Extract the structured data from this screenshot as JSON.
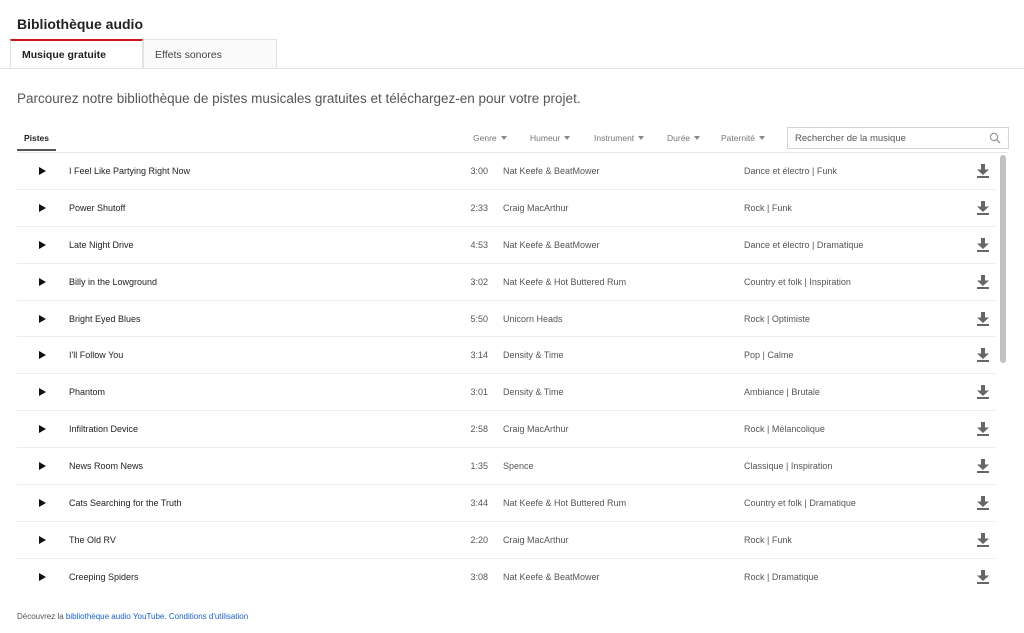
{
  "header": {
    "title": "Bibliothèque audio"
  },
  "tabs": [
    {
      "label": "Musique gratuite",
      "active": true
    },
    {
      "label": "Effets sonores",
      "active": false
    }
  ],
  "intro": "Parcourez notre bibliothèque de pistes musicales gratuites et téléchargez-en pour votre projet.",
  "toolbar": {
    "tracks_tab": "Pistes",
    "filters": [
      "Genre",
      "Humeur",
      "Instrument",
      "Durée",
      "Paternité"
    ],
    "search": {
      "placeholder": "Rechercher de la musique",
      "value": "",
      "icon": "search-icon"
    }
  },
  "tracks": [
    {
      "title": "I Feel Like Partying Right Now",
      "duration": "3:00",
      "artist": "Nat Keefe & BeatMower",
      "genre": "Dance et électro | Funk"
    },
    {
      "title": "Power Shutoff",
      "duration": "2:33",
      "artist": "Craig MacArthur",
      "genre": "Rock | Funk"
    },
    {
      "title": "Late Night Drive",
      "duration": "4:53",
      "artist": "Nat Keefe & BeatMower",
      "genre": "Dance et électro | Dramatique"
    },
    {
      "title": "Billy in the Lowground",
      "duration": "3:02",
      "artist": "Nat Keefe & Hot Buttered Rum",
      "genre": "Country et folk | Inspiration"
    },
    {
      "title": "Bright Eyed Blues",
      "duration": "5:50",
      "artist": "Unicorn Heads",
      "genre": "Rock | Optimiste"
    },
    {
      "title": "I'll Follow You",
      "duration": "3:14",
      "artist": "Density & Time",
      "genre": "Pop | Calme"
    },
    {
      "title": "Phantom",
      "duration": "3:01",
      "artist": "Density & Time",
      "genre": "Ambiance | Brutale"
    },
    {
      "title": "Infiltration Device",
      "duration": "2:58",
      "artist": "Craig MacArthur",
      "genre": "Rock | Mélancolique"
    },
    {
      "title": "News Room News",
      "duration": "1:35",
      "artist": "Spence",
      "genre": "Classique | Inspiration"
    },
    {
      "title": "Cats Searching for the Truth",
      "duration": "3:44",
      "artist": "Nat Keefe & Hot Buttered Rum",
      "genre": "Country et folk | Dramatique"
    },
    {
      "title": "The Old RV",
      "duration": "2:20",
      "artist": "Craig MacArthur",
      "genre": "Rock | Funk"
    },
    {
      "title": "Creeping Spiders",
      "duration": "3:08",
      "artist": "Nat Keefe & BeatMower",
      "genre": "Rock | Dramatique"
    }
  ],
  "icons": {
    "play": "play-icon",
    "download": "download-icon",
    "caret": "caret-down-icon"
  },
  "footer": {
    "prefix": "Découvrez la ",
    "library_link": "bibliothèque audio YouTube.",
    "terms_link": "Conditions d'utilisation"
  },
  "colors": {
    "accent": "#cc181e",
    "link": "#1a62c5"
  }
}
